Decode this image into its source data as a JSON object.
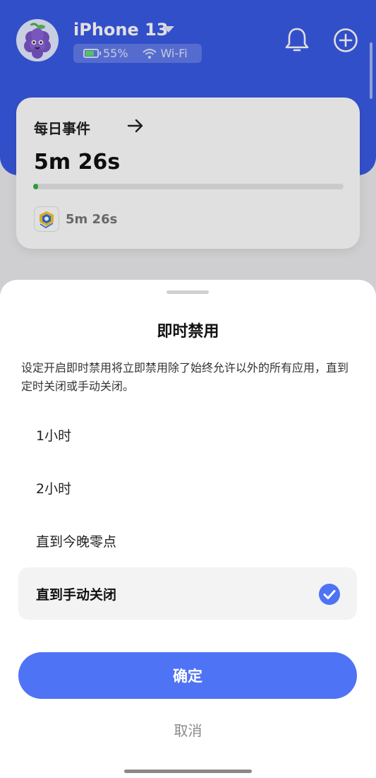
{
  "header": {
    "device_name": "iPhone 13",
    "battery": "55%",
    "network": "Wi-Fi",
    "accent_color": "#3a5be6"
  },
  "daily_card": {
    "title": "每日事件",
    "total_time": "5m 26s",
    "progress_fraction": 0.01,
    "app_time": "5m 26s"
  },
  "sheet": {
    "title": "即时禁用",
    "description": "设定开启即时禁用将立即禁用除了始终允许以外的所有应用，直到定时关闭或手动关闭。",
    "options": [
      {
        "label": "1小时",
        "selected": false
      },
      {
        "label": "2小时",
        "selected": false
      },
      {
        "label": "直到今晚零点",
        "selected": false
      },
      {
        "label": "直到手动关闭",
        "selected": true
      }
    ],
    "confirm_label": "确定",
    "cancel_label": "取消",
    "button_color": "#4f73f5"
  }
}
